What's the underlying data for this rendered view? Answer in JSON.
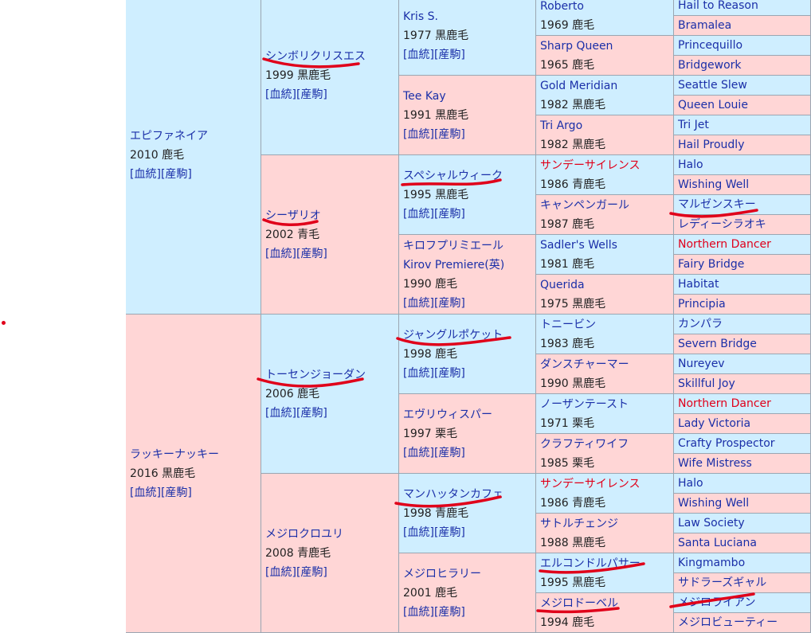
{
  "accent_colors": {
    "male": "#cfeeff",
    "female": "#ffd6d6",
    "link": "#1a2fa8",
    "red_link": "#e0001a",
    "marker": "#e0001a"
  },
  "link_labels": {
    "pedigree": "[血統]",
    "produce": "[産駒]"
  },
  "sires_dams": [
    {
      "id": "g1-0",
      "gen": 1,
      "sex": "male",
      "name": "エピファネイア",
      "year": "2010",
      "coat": "鹿毛",
      "links": true
    },
    {
      "id": "g1-1",
      "gen": 1,
      "sex": "female",
      "name": "ラッキーナッキー",
      "year": "2016",
      "coat": "黒鹿毛",
      "links": true
    },
    {
      "id": "g2-0",
      "gen": 2,
      "sex": "male",
      "name": "シンボリクリスエス",
      "year": "1999",
      "coat": "黒鹿毛",
      "links": true
    },
    {
      "id": "g2-1",
      "gen": 2,
      "sex": "female",
      "name": "シーザリオ",
      "year": "2002",
      "coat": "青毛",
      "links": true
    },
    {
      "id": "g2-2",
      "gen": 2,
      "sex": "male",
      "name": "トーセンジョーダン",
      "year": "2006",
      "coat": "鹿毛",
      "links": true
    },
    {
      "id": "g2-3",
      "gen": 2,
      "sex": "female",
      "name": "メジロクロユリ",
      "year": "2008",
      "coat": "青鹿毛",
      "links": true
    },
    {
      "id": "g3-0",
      "gen": 3,
      "sex": "male",
      "name": "Kris S.",
      "year": "1977",
      "coat": "黒鹿毛",
      "links": true
    },
    {
      "id": "g3-1",
      "gen": 3,
      "sex": "female",
      "name": "Tee Kay",
      "year": "1991",
      "coat": "黒鹿毛",
      "links": true
    },
    {
      "id": "g3-2",
      "gen": 3,
      "sex": "male",
      "name": "スペシャルウィーク",
      "year": "1995",
      "coat": "黒鹿毛",
      "links": true
    },
    {
      "id": "g3-3",
      "gen": 3,
      "sex": "female",
      "name": "キロフプリミエール",
      "alt": "Kirov Premiere(英)",
      "year": "1990",
      "coat": "鹿毛",
      "links": true
    },
    {
      "id": "g3-4",
      "gen": 3,
      "sex": "male",
      "name": "ジャングルポケット",
      "year": "1998",
      "coat": "鹿毛",
      "links": true
    },
    {
      "id": "g3-5",
      "gen": 3,
      "sex": "female",
      "name": "エヴリウィスパー",
      "year": "1997",
      "coat": "栗毛",
      "links": true
    },
    {
      "id": "g3-6",
      "gen": 3,
      "sex": "male",
      "name": "マンハッタンカフェ",
      "year": "1998",
      "coat": "青鹿毛",
      "links": true
    },
    {
      "id": "g3-7",
      "gen": 3,
      "sex": "female",
      "name": "メジロヒラリー",
      "year": "2001",
      "coat": "鹿毛",
      "links": true
    },
    {
      "id": "g4-0",
      "gen": 4,
      "sex": "male",
      "name": "Roberto",
      "year": "1969",
      "coat": "鹿毛"
    },
    {
      "id": "g4-1",
      "gen": 4,
      "sex": "female",
      "name": "Sharp Queen",
      "year": "1965",
      "coat": "鹿毛"
    },
    {
      "id": "g4-2",
      "gen": 4,
      "sex": "male",
      "name": "Gold Meridian",
      "year": "1982",
      "coat": "黒鹿毛"
    },
    {
      "id": "g4-3",
      "gen": 4,
      "sex": "female",
      "name": "Tri Argo",
      "year": "1982",
      "coat": "黒鹿毛"
    },
    {
      "id": "g4-4",
      "gen": 4,
      "sex": "male",
      "name": "サンデーサイレンス",
      "year": "1986",
      "coat": "青鹿毛",
      "red": true
    },
    {
      "id": "g4-5",
      "gen": 4,
      "sex": "female",
      "name": "キャンペンガール",
      "year": "1987",
      "coat": "鹿毛"
    },
    {
      "id": "g4-6",
      "gen": 4,
      "sex": "male",
      "name": "Sadler's Wells",
      "year": "1981",
      "coat": "鹿毛"
    },
    {
      "id": "g4-7",
      "gen": 4,
      "sex": "female",
      "name": "Querida",
      "year": "1975",
      "coat": "黒鹿毛"
    },
    {
      "id": "g4-8",
      "gen": 4,
      "sex": "male",
      "name": "トニービン",
      "year": "1983",
      "coat": "鹿毛"
    },
    {
      "id": "g4-9",
      "gen": 4,
      "sex": "female",
      "name": "ダンスチャーマー",
      "year": "1990",
      "coat": "黒鹿毛"
    },
    {
      "id": "g4-10",
      "gen": 4,
      "sex": "male",
      "name": "ノーザンテースト",
      "year": "1971",
      "coat": "栗毛"
    },
    {
      "id": "g4-11",
      "gen": 4,
      "sex": "female",
      "name": "クラフティワイフ",
      "year": "1985",
      "coat": "栗毛"
    },
    {
      "id": "g4-12",
      "gen": 4,
      "sex": "male",
      "name": "サンデーサイレンス",
      "year": "1986",
      "coat": "青鹿毛",
      "red": true
    },
    {
      "id": "g4-13",
      "gen": 4,
      "sex": "female",
      "name": "サトルチェンジ",
      "year": "1988",
      "coat": "黒鹿毛"
    },
    {
      "id": "g4-14",
      "gen": 4,
      "sex": "male",
      "name": "エルコンドルパサー",
      "year": "1995",
      "coat": "黒鹿毛"
    },
    {
      "id": "g4-15",
      "gen": 4,
      "sex": "female",
      "name": "メジロドーベル",
      "year": "1994",
      "coat": "鹿毛"
    },
    {
      "id": "g5-0",
      "gen": 5,
      "sex": "male",
      "name": "Hail to Reason"
    },
    {
      "id": "g5-1",
      "gen": 5,
      "sex": "female",
      "name": "Bramalea"
    },
    {
      "id": "g5-2",
      "gen": 5,
      "sex": "male",
      "name": "Princequillo"
    },
    {
      "id": "g5-3",
      "gen": 5,
      "sex": "female",
      "name": "Bridgework"
    },
    {
      "id": "g5-4",
      "gen": 5,
      "sex": "male",
      "name": "Seattle Slew"
    },
    {
      "id": "g5-5",
      "gen": 5,
      "sex": "female",
      "name": "Queen Louie"
    },
    {
      "id": "g5-6",
      "gen": 5,
      "sex": "male",
      "name": "Tri Jet"
    },
    {
      "id": "g5-7",
      "gen": 5,
      "sex": "female",
      "name": "Hail Proudly"
    },
    {
      "id": "g5-8",
      "gen": 5,
      "sex": "male",
      "name": "Halo"
    },
    {
      "id": "g5-9",
      "gen": 5,
      "sex": "female",
      "name": "Wishing Well"
    },
    {
      "id": "g5-10",
      "gen": 5,
      "sex": "male",
      "name": "マルゼンスキー"
    },
    {
      "id": "g5-11",
      "gen": 5,
      "sex": "female",
      "name": "レディーシラオキ"
    },
    {
      "id": "g5-12",
      "gen": 5,
      "sex": "male",
      "name": "Northern Dancer",
      "red": true
    },
    {
      "id": "g5-13",
      "gen": 5,
      "sex": "female",
      "name": "Fairy Bridge"
    },
    {
      "id": "g5-14",
      "gen": 5,
      "sex": "male",
      "name": "Habitat"
    },
    {
      "id": "g5-15",
      "gen": 5,
      "sex": "female",
      "name": "Principia"
    },
    {
      "id": "g5-16",
      "gen": 5,
      "sex": "male",
      "name": "カンパラ"
    },
    {
      "id": "g5-17",
      "gen": 5,
      "sex": "female",
      "name": "Severn Bridge"
    },
    {
      "id": "g5-18",
      "gen": 5,
      "sex": "male",
      "name": "Nureyev"
    },
    {
      "id": "g5-19",
      "gen": 5,
      "sex": "female",
      "name": "Skillful Joy"
    },
    {
      "id": "g5-20",
      "gen": 5,
      "sex": "male",
      "name": "Northern Dancer",
      "red": true
    },
    {
      "id": "g5-21",
      "gen": 5,
      "sex": "female",
      "name": "Lady Victoria"
    },
    {
      "id": "g5-22",
      "gen": 5,
      "sex": "male",
      "name": "Crafty Prospector"
    },
    {
      "id": "g5-23",
      "gen": 5,
      "sex": "female",
      "name": "Wife Mistress"
    },
    {
      "id": "g5-24",
      "gen": 5,
      "sex": "male",
      "name": "Halo"
    },
    {
      "id": "g5-25",
      "gen": 5,
      "sex": "female",
      "name": "Wishing Well"
    },
    {
      "id": "g5-26",
      "gen": 5,
      "sex": "male",
      "name": "Law Society"
    },
    {
      "id": "g5-27",
      "gen": 5,
      "sex": "female",
      "name": "Santa Luciana"
    },
    {
      "id": "g5-28",
      "gen": 5,
      "sex": "male",
      "name": "Kingmambo"
    },
    {
      "id": "g5-29",
      "gen": 5,
      "sex": "female",
      "name": "サドラーズギャル"
    },
    {
      "id": "g5-30",
      "gen": 5,
      "sex": "male",
      "name": "メジロライアン"
    },
    {
      "id": "g5-31",
      "gen": 5,
      "sex": "female",
      "name": "メジロビューティー"
    }
  ],
  "highlighted_names": [
    "シンボリクリスエス",
    "シーザリオ",
    "スペシャルウィーク",
    "マルゼンスキー",
    "ジャングルポケット",
    "トーセンジョーダン",
    "マンハッタンカフェ",
    "エルコンドルパサー",
    "メジロドーベル",
    "メジロライアン"
  ]
}
